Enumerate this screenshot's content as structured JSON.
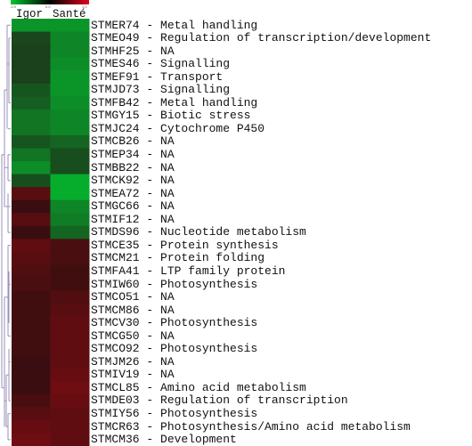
{
  "chart_data": {
    "type": "heatmap",
    "title": "",
    "columns": [
      "Igor",
      "Santé"
    ],
    "color_scale": {
      "min": -1.0,
      "mid": 0.0,
      "max": 1.0,
      "min_color": "#00c832",
      "mid_color": "#000000",
      "max_color": "#e0001e",
      "tick_labels": [
        "-1.0",
        "0.0",
        "1.0"
      ]
    },
    "rows": [
      {
        "gene": "STMER74",
        "annotation": "Metal handling",
        "values": [
          -0.65,
          -0.65
        ]
      },
      {
        "gene": "STMEO49",
        "annotation": "Regulation of transcription/development",
        "values": [
          -0.15,
          -0.55
        ]
      },
      {
        "gene": "STMHF25",
        "annotation": "NA",
        "values": [
          -0.12,
          -0.55
        ]
      },
      {
        "gene": "STMES46",
        "annotation": "Signalling",
        "values": [
          -0.12,
          -0.6
        ]
      },
      {
        "gene": "STMEF91",
        "annotation": "Transport",
        "values": [
          -0.12,
          -0.65
        ]
      },
      {
        "gene": "STMJD73",
        "annotation": "Signalling",
        "values": [
          -0.25,
          -0.65
        ]
      },
      {
        "gene": "STMFB42",
        "annotation": "Metal handling",
        "values": [
          -0.3,
          -0.6
        ]
      },
      {
        "gene": "STMGY15",
        "annotation": "Biotic stress",
        "values": [
          -0.45,
          -0.55
        ]
      },
      {
        "gene": "STMJC24",
        "annotation": "Cytochrome P450",
        "values": [
          -0.45,
          -0.55
        ]
      },
      {
        "gene": "STMCB26",
        "annotation": "NA",
        "values": [
          -0.25,
          -0.35
        ]
      },
      {
        "gene": "STMEP34",
        "annotation": "NA",
        "values": [
          -0.45,
          -0.2
        ]
      },
      {
        "gene": "STMBB22",
        "annotation": "NA",
        "values": [
          -0.6,
          -0.2
        ]
      },
      {
        "gene": "STMCK92",
        "annotation": "NA",
        "values": [
          -0.2,
          -0.8
        ]
      },
      {
        "gene": "STMEA72",
        "annotation": "NA",
        "values": [
          0.35,
          -0.8
        ]
      },
      {
        "gene": "STMGC66",
        "annotation": "NA",
        "values": [
          0.15,
          -0.55
        ]
      },
      {
        "gene": "STMIF12",
        "annotation": "NA",
        "values": [
          0.35,
          -0.5
        ]
      },
      {
        "gene": "STMDS96",
        "annotation": "Nucleotide metabolism",
        "values": [
          0.15,
          -0.35
        ]
      },
      {
        "gene": "STMCE35",
        "annotation": "Protein synthesis",
        "values": [
          0.4,
          0.25
        ]
      },
      {
        "gene": "STMCM21",
        "annotation": "Protein folding",
        "values": [
          0.35,
          0.25
        ]
      },
      {
        "gene": "STMFA41",
        "annotation": "LTP family protein",
        "values": [
          0.3,
          0.2
        ]
      },
      {
        "gene": "STMIW60",
        "annotation": "Photosynthesis",
        "values": [
          0.25,
          0.2
        ]
      },
      {
        "gene": "STMCO51",
        "annotation": "NA",
        "values": [
          0.2,
          0.3
        ]
      },
      {
        "gene": "STMCM86",
        "annotation": "NA",
        "values": [
          0.2,
          0.35
        ]
      },
      {
        "gene": "STMCV30",
        "annotation": "Photosynthesis",
        "values": [
          0.2,
          0.4
        ]
      },
      {
        "gene": "STMCG50",
        "annotation": "NA",
        "values": [
          0.2,
          0.4
        ]
      },
      {
        "gene": "STMCO92",
        "annotation": "Photosynthesis",
        "values": [
          0.2,
          0.4
        ]
      },
      {
        "gene": "STMJM26",
        "annotation": "NA",
        "values": [
          0.15,
          0.4
        ]
      },
      {
        "gene": "STMIV19",
        "annotation": "NA",
        "values": [
          0.15,
          0.45
        ]
      },
      {
        "gene": "STMCL85",
        "annotation": "Amino acid metabolism",
        "values": [
          0.15,
          0.5
        ]
      },
      {
        "gene": "STMDE03",
        "annotation": "Regulation of transcription",
        "values": [
          0.25,
          0.45
        ]
      },
      {
        "gene": "STMIY56",
        "annotation": "Photosynthesis",
        "values": [
          0.35,
          0.4
        ]
      },
      {
        "gene": "STMCR63",
        "annotation": "Photosynthesis/Amino acid metabolism",
        "values": [
          0.45,
          0.4
        ]
      },
      {
        "gene": "STMCM36",
        "annotation": "Development",
        "values": [
          0.5,
          0.4
        ]
      }
    ],
    "dendrogram": "row clustering tree on left side",
    "legend": "top-left"
  }
}
